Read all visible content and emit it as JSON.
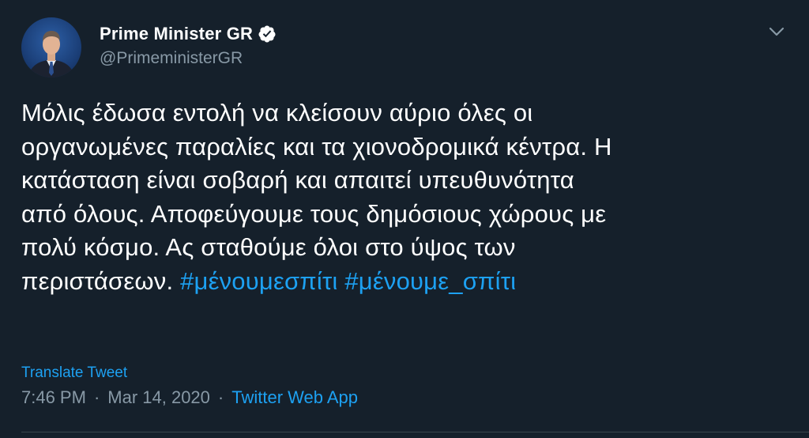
{
  "author": {
    "display_name": "Prime Minister GR",
    "handle": "@PrimeministerGR",
    "verified": true
  },
  "icons": {
    "verified": "verified-badge-icon",
    "caret": "chevron-down-icon"
  },
  "tweet": {
    "lines": [
      "Μόλις έδωσα εντολή να κλείσουν αύριο όλες οι",
      "οργανωμένες παραλίες και τα χιονοδρομικά κέντρα. Η",
      "κατάσταση είναι σοβαρή και απαιτεί υπευθυνότητα",
      "από όλους. Αποφεύγουμε τους δημόσιους χώρους με",
      "πολύ κόσμο. Ας σταθούμε όλοι στο ύψος των"
    ],
    "last_line_text": "περιστάσεων. ",
    "hashtags": [
      "#μένουμεσπίτι",
      "#μένουμε_σπίτι"
    ]
  },
  "translate_label": "Translate Tweet",
  "meta": {
    "time": "7:46 PM",
    "separator": "·",
    "date": "Mar 14, 2020",
    "source": "Twitter Web App"
  },
  "colors": {
    "background": "#15202b",
    "text": "#ffffff",
    "secondary": "#8899a6",
    "accent": "#1da1f2"
  }
}
